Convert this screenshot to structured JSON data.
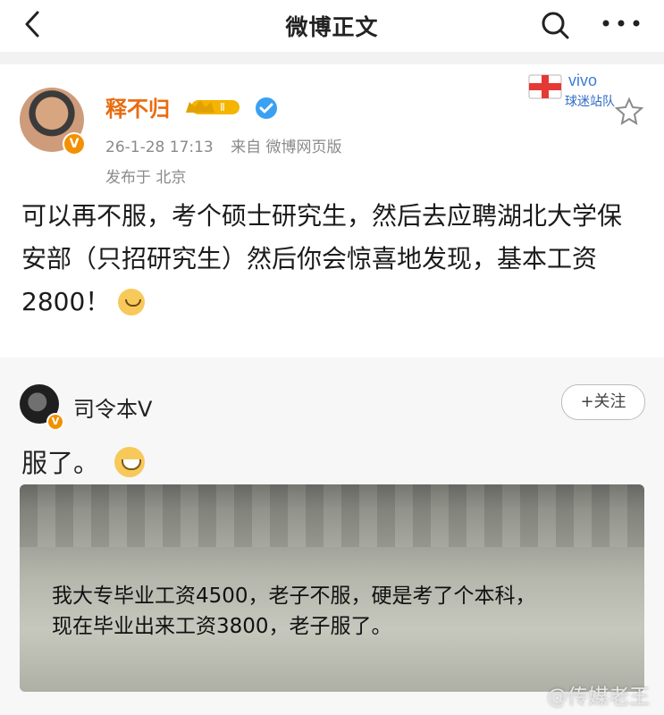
{
  "header": {
    "title": "微博正文"
  },
  "post": {
    "author": "释不归",
    "badge_level": "Ⅱ",
    "meta_time": "26-1-28 17:13",
    "meta_source": "来自 微博网页版",
    "location": "发布于 北京",
    "text": "可以再不服，考个硕士研究生，然后去应聘湖北大学保安部（只招研究生）然后你会惊喜地发现，基本工资2800！",
    "brand_text": "vivo",
    "brand_sub": "球迷站队"
  },
  "repost": {
    "author": "司令本V",
    "follow_label": "+关注",
    "text": "服了。",
    "image_text_line1": "我大专毕业工资4500，老子不服，硬是考了个本科，",
    "image_text_line2": "现在毕业出来工资3800，老子服了。"
  },
  "watermark": "@传媒老王",
  "colors": {
    "accent": "#e86c0f",
    "badge": "#f29100",
    "verify_blue": "#3aa0f2"
  }
}
